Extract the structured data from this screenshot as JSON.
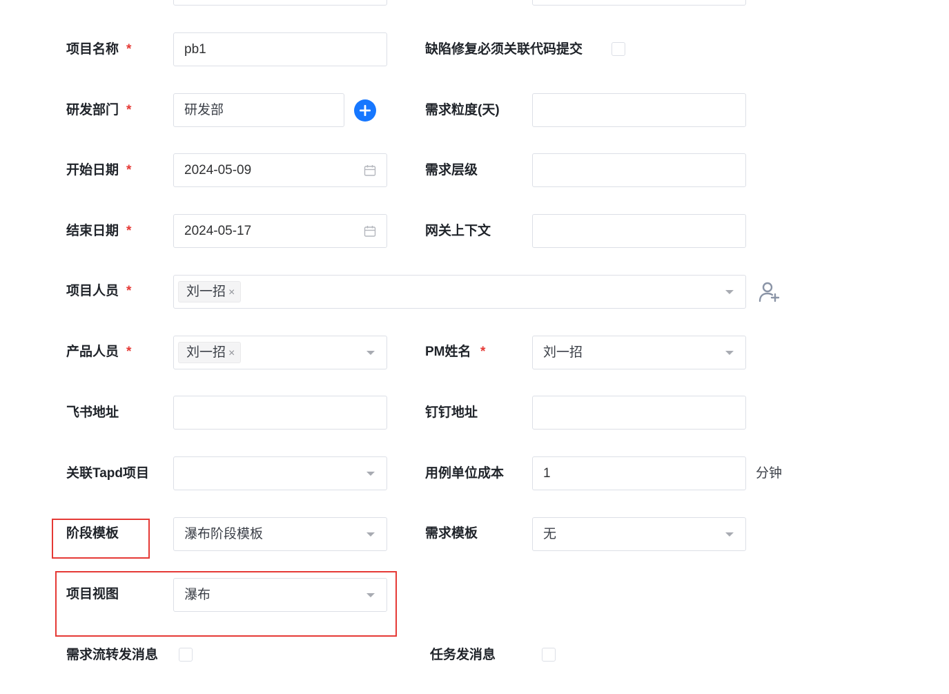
{
  "form": {
    "project_name": {
      "label": "项目名称",
      "required_mark": "*",
      "value": "pb1"
    },
    "defect_fix_commit": {
      "label": "缺陷修复必须关联代码提交",
      "checked": false
    },
    "dept": {
      "label": "研发部门",
      "required_mark": "*",
      "value": "研发部",
      "add_icon": "plus-circle-icon"
    },
    "req_granularity": {
      "label": "需求粒度(天)",
      "value": ""
    },
    "start_date": {
      "label": "开始日期",
      "required_mark": "*",
      "value": "2024-05-09",
      "icon": "calendar-icon"
    },
    "req_level": {
      "label": "需求层级",
      "value": ""
    },
    "end_date": {
      "label": "结束日期",
      "required_mark": "*",
      "value": "2024-05-17",
      "icon": "calendar-icon"
    },
    "gateway_ctx": {
      "label": "网关上下文",
      "value": ""
    },
    "members": {
      "label": "项目人员",
      "required_mark": "*",
      "tags": [
        "刘一招"
      ],
      "remove_glyph": "×",
      "add_icon": "user-add-icon"
    },
    "product_members": {
      "label": "产品人员",
      "required_mark": "*",
      "tags": [
        "刘一招"
      ],
      "remove_glyph": "×"
    },
    "pm_name": {
      "label": "PM姓名",
      "required_mark": "*",
      "value": "刘一招"
    },
    "feishu": {
      "label": "飞书地址",
      "value": ""
    },
    "dingding": {
      "label": "钉钉地址",
      "value": ""
    },
    "tapd": {
      "label": "关联Tapd项目",
      "value": ""
    },
    "case_cost": {
      "label": "用例单位成本",
      "value": "1",
      "unit": "分钟"
    },
    "stage_template": {
      "label": "阶段模板",
      "value": "瀑布阶段模板"
    },
    "req_template": {
      "label": "需求模板",
      "value": "无"
    },
    "project_view": {
      "label": "项目视图",
      "value": "瀑布"
    },
    "req_flow_msg": {
      "label": "需求流转发消息",
      "checked": false
    },
    "task_msg": {
      "label": "任务发消息",
      "checked": false
    }
  },
  "colors": {
    "required": "#e53935",
    "accent": "#1677ff",
    "highlight": "#e53935",
    "border": "#dcdfe6"
  }
}
